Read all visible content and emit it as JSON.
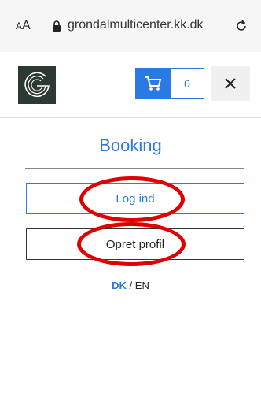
{
  "browser": {
    "text_size_small": "A",
    "text_size_big": "A",
    "url": "grondalmulticenter.kk.dk"
  },
  "header": {
    "cart_count": "0"
  },
  "page": {
    "title": "Booking",
    "login_label": "Log ind",
    "create_profile_label": "Opret profil"
  },
  "language": {
    "active": "DK",
    "separator": " / ",
    "other": "EN"
  },
  "colors": {
    "accent": "#2a7ae4",
    "highlight": "#e10000",
    "logo_bg": "#2d3a33"
  },
  "icons": [
    "lock-icon",
    "reload-icon",
    "cart-icon",
    "close-icon",
    "logo-g"
  ]
}
